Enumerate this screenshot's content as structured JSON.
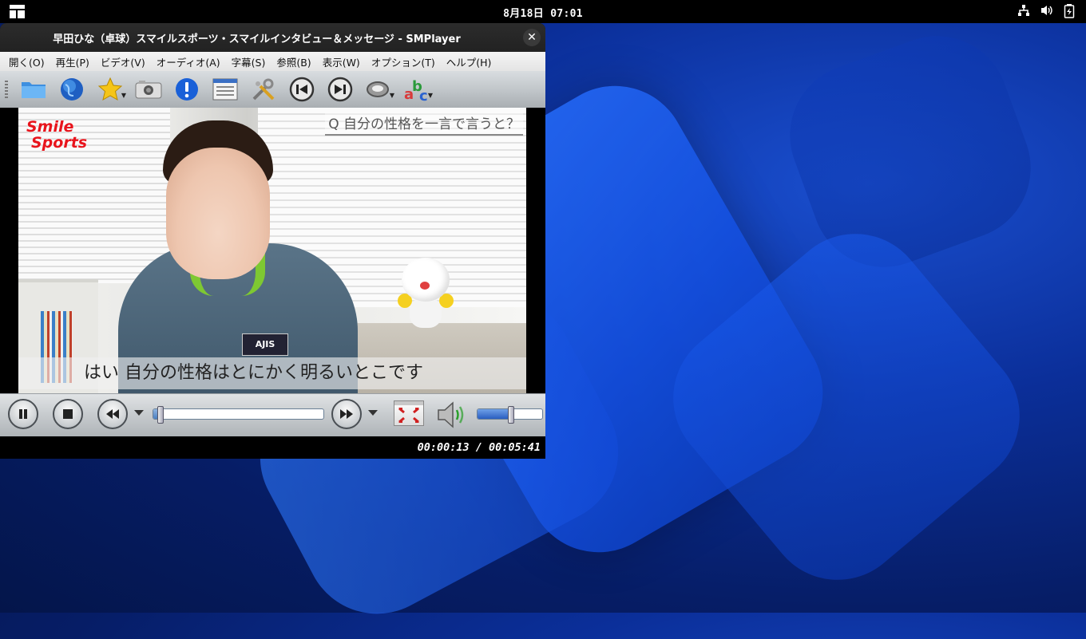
{
  "topbar": {
    "clock": "8月18日 07:01",
    "icons": [
      "apps-icon",
      "network-icon",
      "volume-icon",
      "battery-icon"
    ]
  },
  "window": {
    "title": "早田ひな（卓球）スマイルスポーツ・スマイルインタビュー＆メッセージ - SMPlayer",
    "close_label": "✕"
  },
  "menu": {
    "items": [
      {
        "label": "開く(O)"
      },
      {
        "label": "再生(P)"
      },
      {
        "label": "ビデオ(V)"
      },
      {
        "label": "オーディオ(A)"
      },
      {
        "label": "字幕(S)"
      },
      {
        "label": "参照(B)"
      },
      {
        "label": "表示(W)"
      },
      {
        "label": "オプション(T)"
      },
      {
        "label": "ヘルプ(H)"
      }
    ]
  },
  "toolbar": {
    "buttons": [
      "open-folder-icon",
      "open-url-icon",
      "favorites-icon",
      "screenshot-icon",
      "info-icon",
      "playlist-icon",
      "preferences-icon",
      "previous-icon",
      "next-icon",
      "audio-track-icon",
      "subtitle-track-icon"
    ]
  },
  "video": {
    "logo_line1": "Smile",
    "logo_line2": "Sports",
    "question": "Q 自分の性格を一言で言うと？",
    "subtitle": "はい 自分の性格はとにかく明るいとこです",
    "badge": "AJIS"
  },
  "controls": {
    "seek_progress": 0.038,
    "volume_level": 0.5,
    "accent_color": "#4a7fc0"
  },
  "status": {
    "time": "00:00:13 / 00:05:41"
  }
}
